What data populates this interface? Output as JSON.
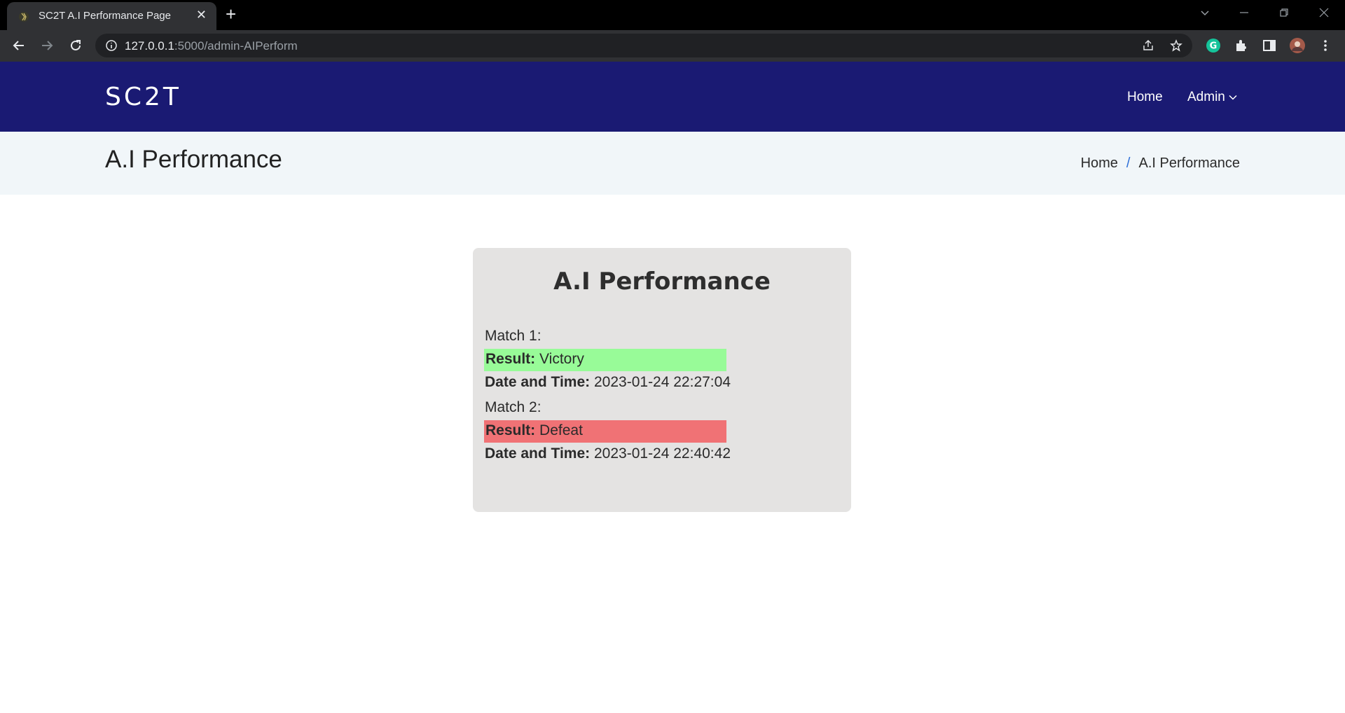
{
  "browser": {
    "tab_title": "SC2T A.I Performance Page",
    "url_host": "127.0.0.1",
    "url_path": ":5000/admin-AIPerform"
  },
  "header": {
    "logo": "SC2T",
    "nav": {
      "home": "Home",
      "admin": "Admin"
    }
  },
  "page_header": {
    "title": "A.I Performance",
    "breadcrumb": {
      "home": "Home",
      "separator": "/",
      "current": "A.I Performance"
    }
  },
  "card": {
    "title": "A.I Performance",
    "result_label": "Result:",
    "datetime_label": "Date and Time:",
    "matches": [
      {
        "label": "Match 1:",
        "result": "Victory",
        "datetime": "2023-01-24 22:27:04",
        "color": "#98fb98"
      },
      {
        "label": "Match 2:",
        "result": "Defeat",
        "datetime": "2023-01-24 22:40:42",
        "color": "#f07275"
      }
    ]
  },
  "colors": {
    "header_bg": "#1a1a73",
    "crumb_bg": "#f1f6f9",
    "card_bg": "#e4e3e2",
    "breadcrumb_separator": "#2e6fd8"
  }
}
